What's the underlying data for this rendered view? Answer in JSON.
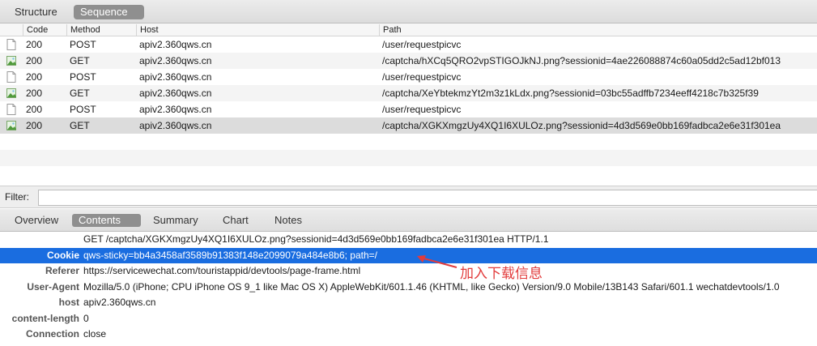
{
  "view_tabs": [
    {
      "label": "Structure",
      "active": false
    },
    {
      "label": "Sequence",
      "active": true
    }
  ],
  "columns": {
    "code": "Code",
    "method": "Method",
    "host": "Host",
    "path": "Path"
  },
  "requests": [
    {
      "icon": "document-icon",
      "code": "200",
      "method": "POST",
      "host": "apiv2.360qws.cn",
      "path": "/user/requestpicvc"
    },
    {
      "icon": "image-icon",
      "code": "200",
      "method": "GET",
      "host": "apiv2.360qws.cn",
      "path": "/captcha/hXCq5QRO2vpSTIGOJkNJ.png?sessionid=4ae226088874c60a05dd2c5ad12bf013"
    },
    {
      "icon": "document-icon",
      "code": "200",
      "method": "POST",
      "host": "apiv2.360qws.cn",
      "path": "/user/requestpicvc"
    },
    {
      "icon": "image-icon",
      "code": "200",
      "method": "GET",
      "host": "apiv2.360qws.cn",
      "path": "/captcha/XeYbtekmzYt2m3z1kLdx.png?sessionid=03bc55adffb7234eeff4218c7b325f39"
    },
    {
      "icon": "document-icon",
      "code": "200",
      "method": "POST",
      "host": "apiv2.360qws.cn",
      "path": "/user/requestpicvc"
    },
    {
      "icon": "image-icon",
      "code": "200",
      "method": "GET",
      "host": "apiv2.360qws.cn",
      "path": "/captcha/XGKXmgzUy4XQ1I6XULOz.png?sessionid=4d3d569e0bb169fadbca2e6e31f301ea"
    }
  ],
  "filter": {
    "label": "Filter:",
    "value": ""
  },
  "detail_tabs": [
    {
      "label": "Overview",
      "active": false
    },
    {
      "label": "Contents",
      "active": true
    },
    {
      "label": "Summary",
      "active": false
    },
    {
      "label": "Chart",
      "active": false
    },
    {
      "label": "Notes",
      "active": false
    }
  ],
  "request_line": "GET /captcha/XGKXmgzUy4XQ1I6XULOz.png?sessionid=4d3d569e0bb169fadbca2e6e31f301ea HTTP/1.1",
  "headers": [
    {
      "key": "Cookie",
      "value": "qws-sticky=bb4a3458af3589b91383f148e2099079a484e8b6; path=/"
    },
    {
      "key": "Referer",
      "value": "https://servicewechat.com/touristappid/devtools/page-frame.html"
    },
    {
      "key": "User-Agent",
      "value": "Mozilla/5.0 (iPhone; CPU iPhone OS 9_1 like Mac OS X) AppleWebKit/601.1.46 (KHTML, like Gecko) Version/9.0 Mobile/13B143 Safari/601.1 wechatdevtools/1.0"
    },
    {
      "key": "host",
      "value": "apiv2.360qws.cn"
    },
    {
      "key": "content-length",
      "value": "0"
    },
    {
      "key": "Connection",
      "value": "close"
    }
  ],
  "annotation": {
    "text": "加入下载信息",
    "color": "#e23b3b"
  },
  "colors": {
    "selection": "#1a6de0",
    "active_tab": "#8f8f8f"
  }
}
